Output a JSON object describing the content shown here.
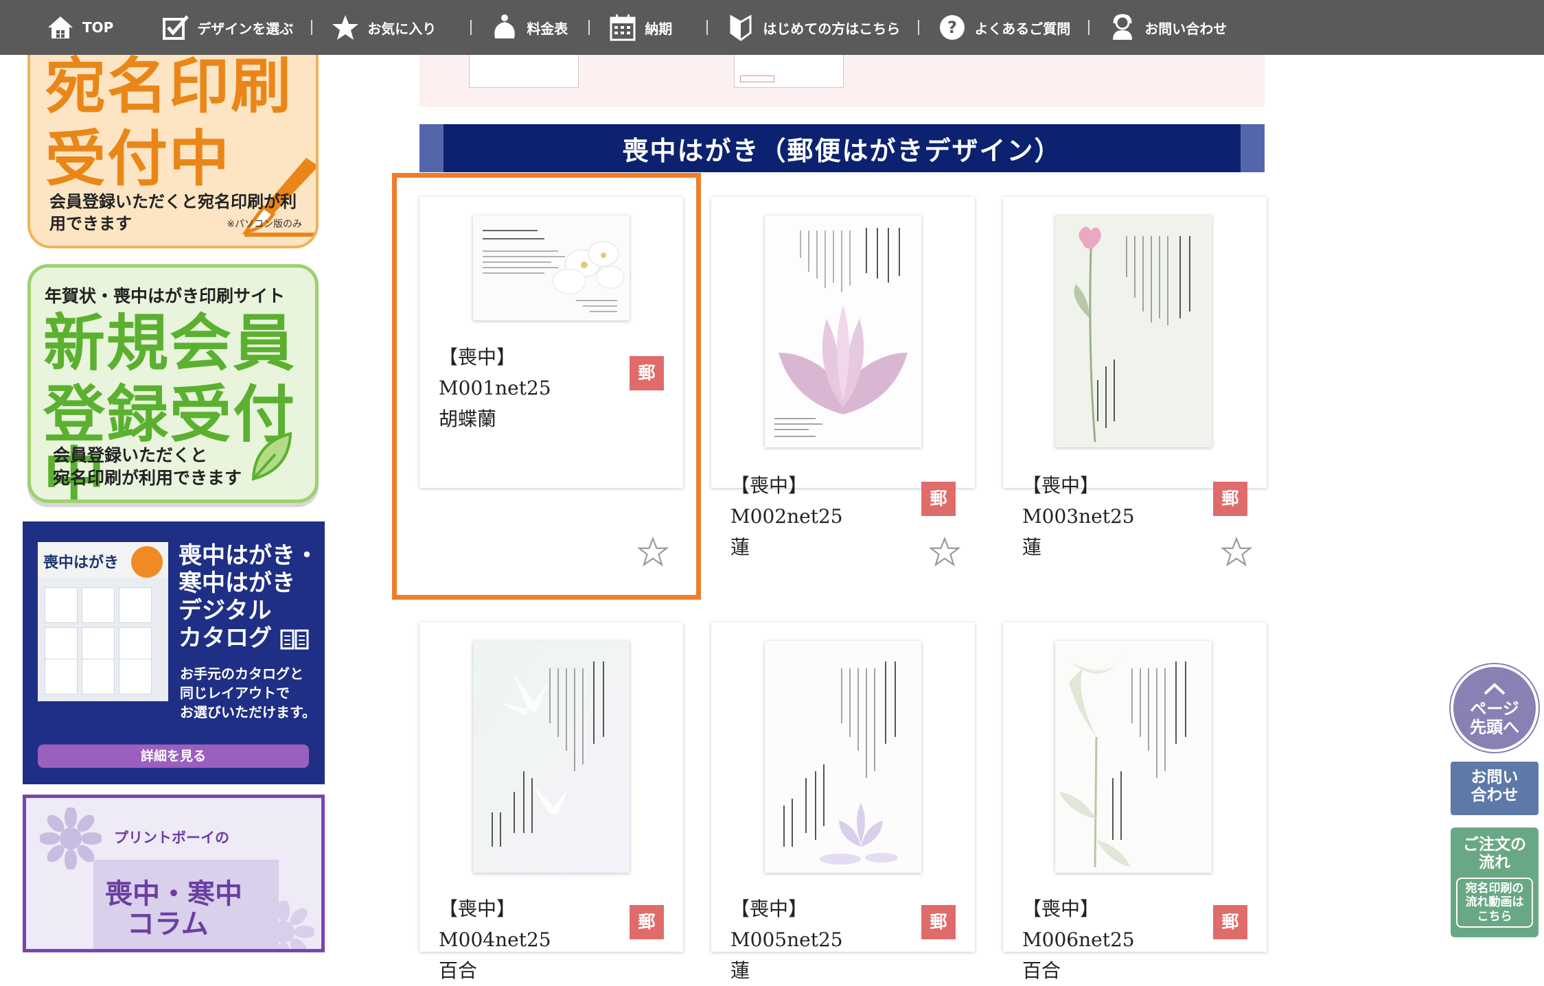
{
  "nav": {
    "items": [
      {
        "label": "TOP",
        "icon": "home-icon"
      },
      {
        "label": "デザインを選ぶ",
        "icon": "checkbox-icon"
      },
      {
        "label": "お気に入り",
        "icon": "star-icon"
      },
      {
        "label": "料金表",
        "icon": "money-bag-icon"
      },
      {
        "label": "納期",
        "icon": "calendar-icon"
      },
      {
        "label": "はじめての方はこちら",
        "icon": "beginner-mark-icon"
      },
      {
        "label": "よくあるご質問",
        "icon": "question-icon"
      },
      {
        "label": "お問い合わせ",
        "icon": "operator-icon"
      }
    ]
  },
  "sidebar": {
    "atena": {
      "line1": "宛名印刷",
      "line2": "受付中",
      "sub": "会員登録いただくと宛名印刷が利用できます",
      "note": "※パソコン版のみ"
    },
    "member": {
      "head": "年賀状・喪中はがき印刷サイト",
      "line1": "新規会員",
      "line2": "登録受付中",
      "sub1": "会員登録いただくと",
      "sub2": "宛名印刷が利用できます"
    },
    "catalog": {
      "thumb_title": "喪中はがき",
      "title1": "喪中はがき・",
      "title2": "寒中はがき",
      "title3": "デジタル",
      "title4": "カタログ",
      "desc1": "お手元のカタログと",
      "desc2": "同じレイアウトで",
      "desc3": "お選びいただけます。",
      "button": "詳細を見る"
    },
    "column": {
      "head": "プリントボーイの",
      "line1": "喪中・寒中",
      "line2": "コラム"
    }
  },
  "section": {
    "title": "喪中はがき（郵便はがきデザイン）"
  },
  "products": [
    {
      "line1": "【喪中】M001net25",
      "line2": "胡蝶蘭",
      "badge": "郵"
    },
    {
      "line1": "【喪中】M002net25",
      "line2": "蓮",
      "badge": "郵"
    },
    {
      "line1": "【喪中】M003net25",
      "line2": "蓮",
      "badge": "郵"
    },
    {
      "line1": "【喪中】M004net25",
      "line2": "百合",
      "badge": "郵"
    },
    {
      "line1": "【喪中】M005net25",
      "line2": "蓮",
      "badge": "郵"
    },
    {
      "line1": "【喪中】M006net25",
      "line2": "百合",
      "badge": "郵"
    }
  ],
  "floating": {
    "pagetop_line1": "ページ",
    "pagetop_line2": "先頭へ",
    "contact_line1": "お問い",
    "contact_line2": "合わせ",
    "flow_line1": "ご注文の",
    "flow_line2": "流れ",
    "flow_sub1": "宛名印刷の",
    "flow_sub2": "流れ動画は",
    "flow_sub3": "こちら"
  },
  "colors": {
    "nav_bg": "#5a5a5a",
    "section_bar": "#0c2270",
    "selection_border": "#ef7d2a",
    "postal_badge": "#e06b6b"
  }
}
